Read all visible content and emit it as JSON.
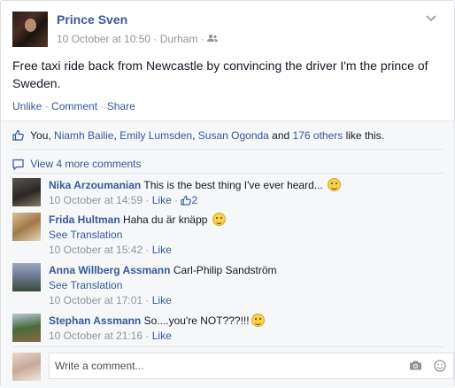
{
  "post": {
    "author": "Prince Sven",
    "date": "10 October at 10:50",
    "meta_sep": "·",
    "location": "Durham",
    "meta_sep2": "·",
    "text": "Free taxi ride back from Newcastle by convincing the driver I'm the prince of Sweden.",
    "actions": {
      "unlike": "Unlike",
      "comment": "Comment",
      "share": "Share",
      "sep": "·"
    }
  },
  "likes": {
    "prefix": "You, ",
    "person1": "Niamh Bailie",
    "sep1": ", ",
    "person2": "Emily Lumsden",
    "sep2": ", ",
    "person3": "Susan Ogonda",
    "and": " and ",
    "others": "176 others",
    "suffix": " like this."
  },
  "view_more": "View 4 more comments",
  "comments": [
    {
      "name": "Nika Arzoumanian",
      "text": "This is the best thing I've ever heard...",
      "time": "10 October at 14:59",
      "like": "Like",
      "like_count": "2",
      "avatar_color": "#3a3a38"
    },
    {
      "name": "Frida Hultman",
      "text": "Haha du är knäpp",
      "translation": "See Translation",
      "time": "10 October at 15:42",
      "like": "Like",
      "avatar_color": "#c9a87a"
    },
    {
      "name": "Anna Willberg Assmann",
      "text": "Carl-Philip Sandström",
      "translation": "See Translation",
      "time": "10 October at 17:01",
      "like": "Like",
      "avatar_color": "#7a8aa0"
    },
    {
      "name": "Stephan Assmann",
      "text": "So....you're NOT???!!!",
      "time": "10 October at 21:16",
      "like": "Like",
      "avatar_color": "#6b8a5a"
    }
  ],
  "reply": {
    "placeholder": "Write a comment..."
  },
  "colors": {
    "link": "#365899",
    "author": "#3b5998",
    "meta": "#90949c",
    "ufi_bg": "#f6f7f9"
  }
}
